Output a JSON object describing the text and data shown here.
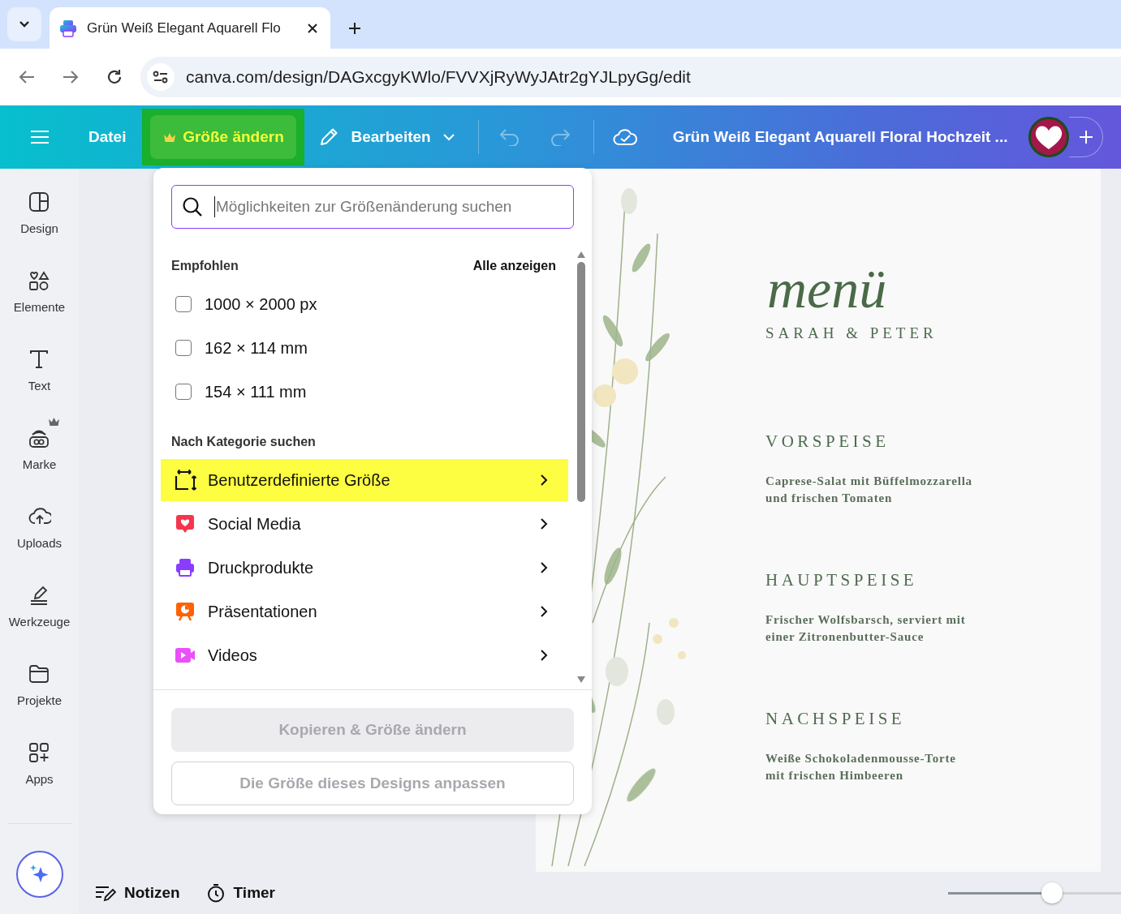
{
  "browser": {
    "tab": {
      "title": "Grün Weiß Elegant Aquarell Flo"
    },
    "url": "canva.com/design/DAGxcgyKWlo/FVVXjRyWyJAtr2gYJLpyGg/edit"
  },
  "toolbar": {
    "file_menu": "Datei",
    "resize": {
      "label": "Größe ändern",
      "premium": true,
      "selected": true
    },
    "edit": {
      "label": "Bearbeiten"
    },
    "undo": {
      "disabled": true
    },
    "redo": {
      "disabled": true
    },
    "design_title": "Grün Weiß Elegant Aquarell Floral Hochzeit ..."
  },
  "sidebar": {
    "items": [
      {
        "label": "Design",
        "premium": false,
        "selected": false
      },
      {
        "label": "Elemente",
        "premium": false,
        "selected": false
      },
      {
        "label": "Text",
        "premium": false,
        "selected": false
      },
      {
        "label": "Marke",
        "premium": true,
        "selected": false
      },
      {
        "label": "Uploads",
        "premium": false,
        "selected": false
      },
      {
        "label": "Werkzeuge",
        "premium": false,
        "selected": false
      },
      {
        "label": "Projekte",
        "premium": false,
        "selected": false
      },
      {
        "label": "Apps",
        "premium": false,
        "selected": false
      }
    ]
  },
  "resize_panel": {
    "search": {
      "placeholder": "Möglichkeiten zur Größenänderung suchen"
    },
    "recommended": {
      "title": "Empfohlen",
      "link": "Alle anzeigen",
      "items": [
        {
          "label": "1000 × 2000 px",
          "checked": false
        },
        {
          "label": "162 × 114 mm",
          "checked": false
        },
        {
          "label": "154 × 111 mm",
          "checked": false
        }
      ]
    },
    "categories": {
      "title": "Nach Kategorie suchen",
      "items": [
        {
          "label": "Benutzerdefinierte Größe",
          "kind": "custom",
          "selected": true
        },
        {
          "label": "Social Media",
          "kind": "social",
          "selected": false
        },
        {
          "label": "Druckprodukte",
          "kind": "print",
          "selected": false
        },
        {
          "label": "Präsentationen",
          "kind": "presentation",
          "selected": false
        },
        {
          "label": "Videos",
          "kind": "video",
          "selected": false
        }
      ]
    },
    "buttons": [
      {
        "label": "Kopieren & Größe ändern",
        "kind": "filled",
        "disabled": true
      },
      {
        "label": "Die Größe dieses Designs anpassen",
        "kind": "outline",
        "disabled": true
      }
    ]
  },
  "design": {
    "title": "menü",
    "couple": "SARAH & PETER",
    "courses": [
      {
        "heading": "VORSPEISE",
        "text": "Caprese-Salat mit Büffelmozzarella\nund frischen Tomaten"
      },
      {
        "heading": "HAUPTSPEISE",
        "text": "Frischer Wolfsbarsch, serviert mit\neiner Zitronenbutter-Sauce"
      },
      {
        "heading": "NACHSPEISE",
        "text": "Weiße Schokoladenmousse-Torte\nmit frischen Himbeeren"
      }
    ]
  },
  "bottom_bar": {
    "notes": "Notizen",
    "timer": "Timer",
    "zoom": {
      "level": 0.6
    }
  }
}
